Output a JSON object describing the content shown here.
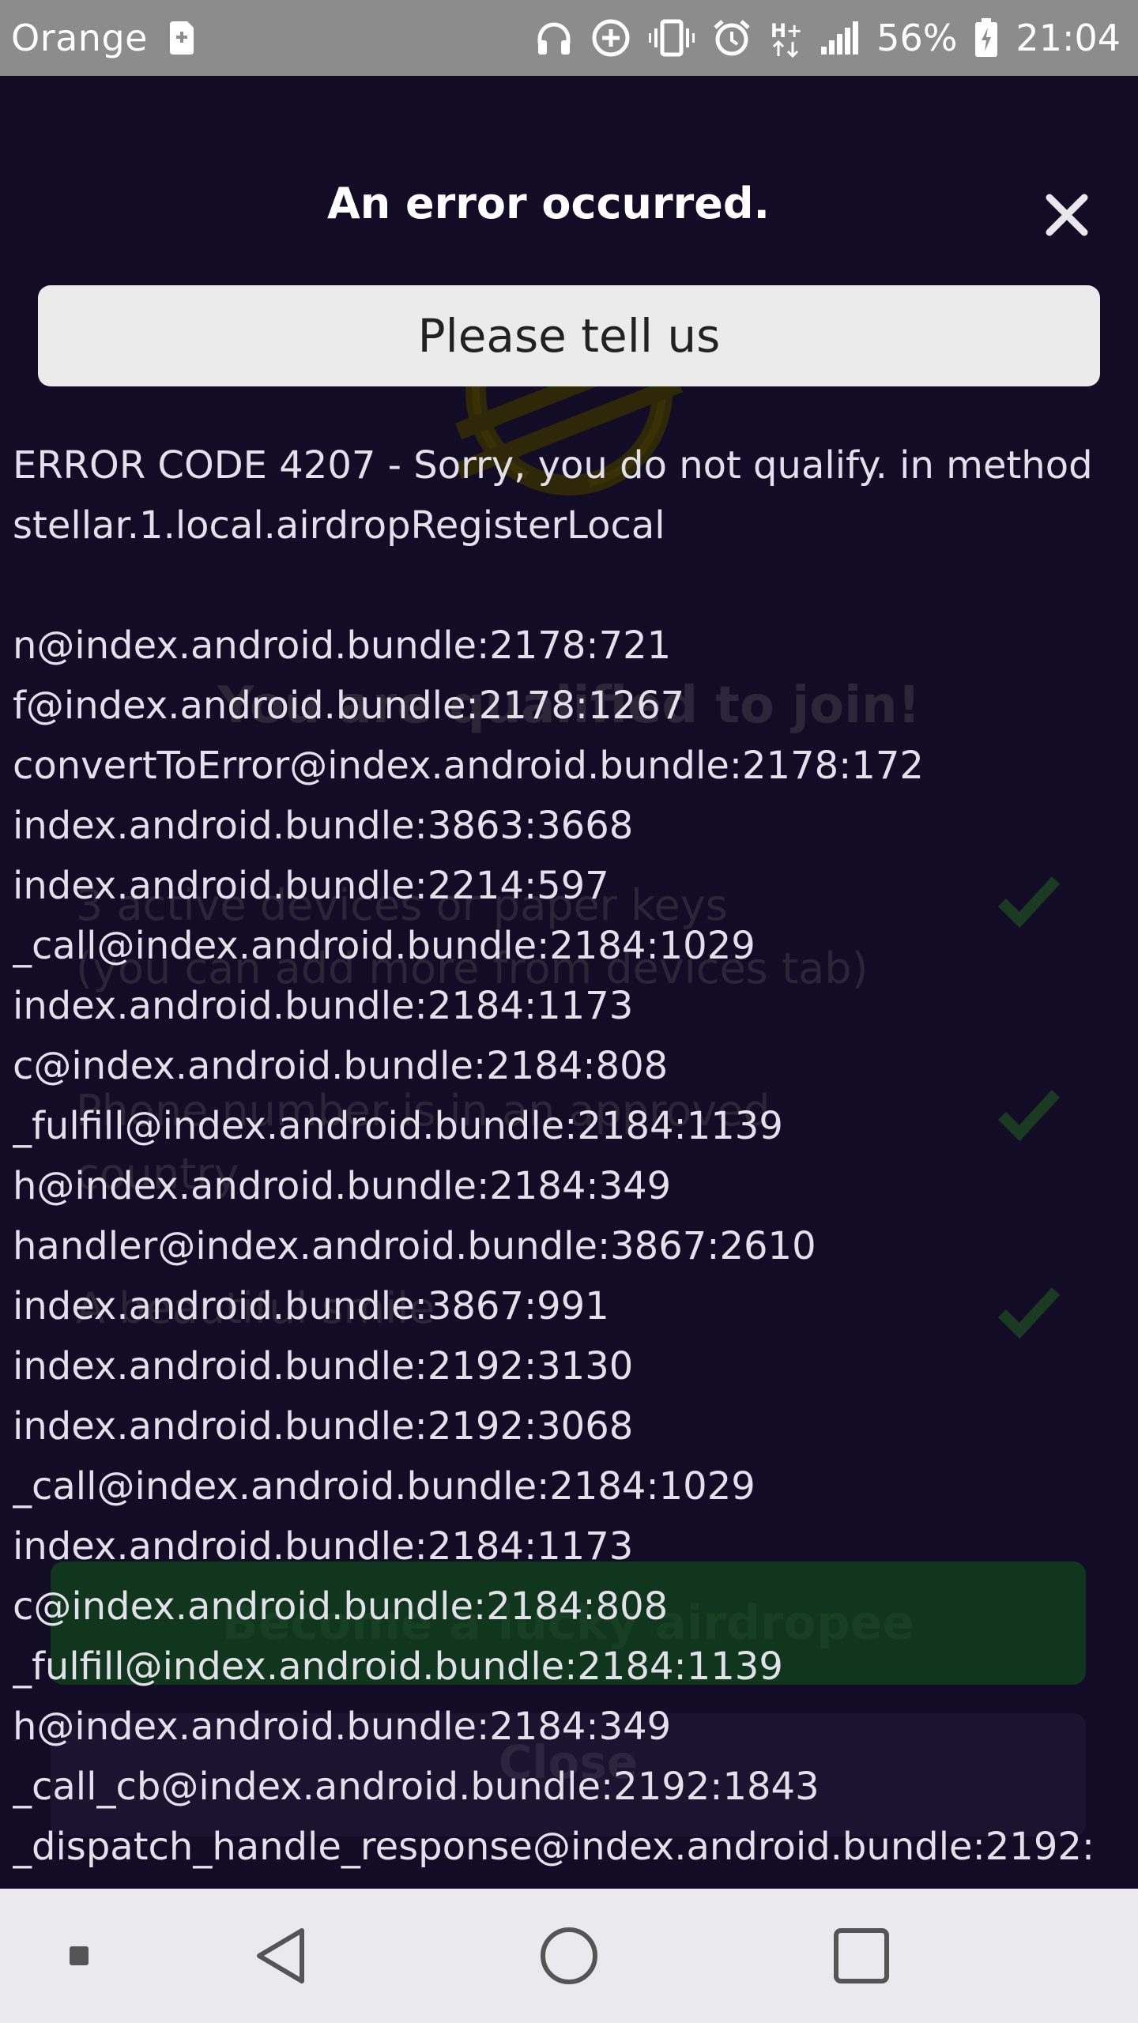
{
  "status_bar": {
    "carrier": "Orange",
    "battery_percent": "56%",
    "time": "21:04",
    "icons": [
      "sim-icon",
      "headphones-icon",
      "data-saver-icon",
      "vibrate-icon",
      "alarm-icon",
      "hplus-icon",
      "signal-icon",
      "battery-icon"
    ]
  },
  "background": {
    "heading": "You are qualified to join!",
    "requirements": [
      {
        "line1": "3 active devices or paper keys",
        "line2": "(you can add more from devices tab)"
      },
      {
        "line1": "Phone number is in an approved",
        "line2": "country"
      },
      {
        "line1": "A beautiful smile",
        "line2": ""
      }
    ],
    "primary_button": "Become a lucky airdropee",
    "secondary_button": "Close",
    "accent_color": "#c8a800",
    "check_color": "#1f4d2a"
  },
  "error": {
    "title": "An error occurred.",
    "tell_us_button": "Please tell us",
    "message_lines": [
      "ERROR CODE 4207 - Sorry, you do not qualify. in method",
      "stellar.1.local.airdropRegisterLocal",
      "",
      "n@index.android.bundle:2178:721",
      "f@index.android.bundle:2178:1267",
      "convertToError@index.android.bundle:2178:172",
      "index.android.bundle:3863:3668",
      "index.android.bundle:2214:597",
      "_call@index.android.bundle:2184:1029",
      "index.android.bundle:2184:1173",
      "c@index.android.bundle:2184:808",
      "_fulfill@index.android.bundle:2184:1139",
      "h@index.android.bundle:2184:349",
      "handler@index.android.bundle:3867:2610",
      "index.android.bundle:3867:991",
      "index.android.bundle:2192:3130",
      "index.android.bundle:2192:3068",
      "_call@index.android.bundle:2184:1029",
      "index.android.bundle:2184:1173",
      "c@index.android.bundle:2184:808",
      "_fulfill@index.android.bundle:2184:1139",
      "h@index.android.bundle:2184:349",
      "_call_cb@index.android.bundle:2192:1843",
      "_dispatch_handle_response@index.android.bundle:2192:"
    ]
  },
  "nav_bar": {
    "buttons": [
      "notification-dot-icon",
      "back-icon",
      "home-icon",
      "recents-icon"
    ]
  }
}
